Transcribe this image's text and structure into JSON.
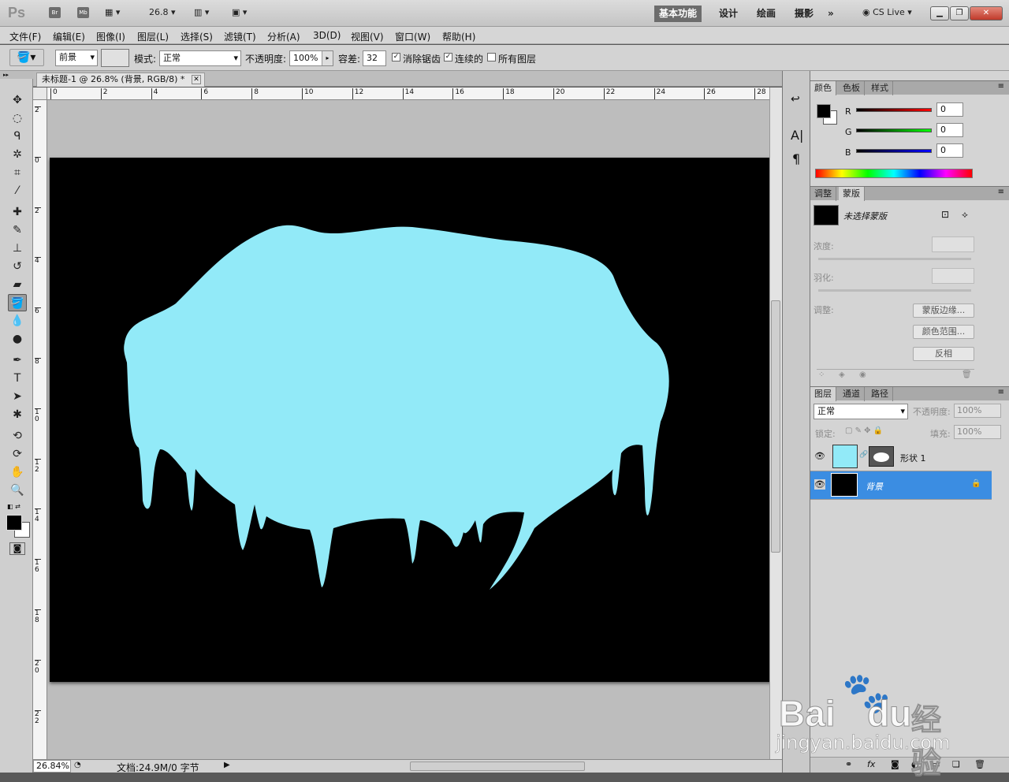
{
  "appbar": {
    "logo": "Ps",
    "bridge": "Br",
    "minibridge": "Mb",
    "zoom": "26.8",
    "workspaces": [
      "基本功能",
      "设计",
      "绘画",
      "摄影"
    ],
    "more": "»",
    "cslive": "CS Live"
  },
  "menu": [
    "文件(F)",
    "编辑(E)",
    "图像(I)",
    "图层(L)",
    "选择(S)",
    "滤镜(T)",
    "分析(A)",
    "3D(D)",
    "视图(V)",
    "窗口(W)",
    "帮助(H)"
  ],
  "options": {
    "fill_source": "前景",
    "mode_label": "模式:",
    "mode_value": "正常",
    "opacity_label": "不透明度:",
    "opacity_value": "100%",
    "tolerance_label": "容差:",
    "tolerance_value": "32",
    "antialias_label": "消除锯齿",
    "antialias": true,
    "contiguous_label": "连续的",
    "contiguous": true,
    "alllayers_label": "所有图层",
    "alllayers": false
  },
  "document": {
    "tab_title": "未标题-1 @ 26.8% (背景, RGB/8) *",
    "ruler_h": [
      "0",
      "2",
      "4",
      "6",
      "8",
      "10",
      "12",
      "14",
      "16",
      "18",
      "20",
      "22",
      "24",
      "26",
      "28"
    ],
    "ruler_v": [
      "2",
      "0",
      "2",
      "4",
      "6",
      "8",
      "1 0",
      "1 2",
      "1 4",
      "1 6",
      "1 8",
      "2 0",
      "2 2",
      "2 4"
    ],
    "shape_color": "#92eaf8",
    "canvas_color": "#000000"
  },
  "status": {
    "zoom": "26.84%",
    "doc": "文档:24.9M/0 字节"
  },
  "color_panel": {
    "tabs": [
      "颜色",
      "色板",
      "样式"
    ],
    "r": "0",
    "g": "0",
    "b": "0",
    "labels": [
      "R",
      "G",
      "B"
    ]
  },
  "masks_panel": {
    "tabs": [
      "调整",
      "蒙版"
    ],
    "no_mask": "未选择蒙版",
    "density": "浓度:",
    "feather": "羽化:",
    "refine": "调整:",
    "edge_btn": "蒙版边缘...",
    "range_btn": "颜色范围...",
    "invert_btn": "反相"
  },
  "layers_panel": {
    "tabs": [
      "图层",
      "通道",
      "路径"
    ],
    "blend": "正常",
    "opacity_label": "不透明度:",
    "opacity": "100%",
    "lock_label": "锁定:",
    "fill_label": "填充:",
    "fill": "100%",
    "layers": [
      {
        "name": "形状 1"
      },
      {
        "name": "背景"
      }
    ]
  },
  "watermark": {
    "brand": "Bai",
    "brand2": "du",
    "cn": "经验",
    "url": "jingyan.baidu.com"
  }
}
